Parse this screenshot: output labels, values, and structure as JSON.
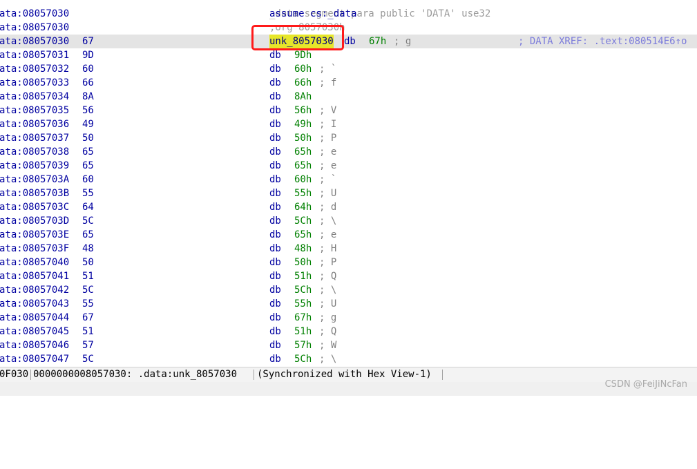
{
  "listing": {
    "partial_top": "_data segment para public 'DATA' use32",
    "rows": [
      {
        "addr": "ata:08057030",
        "bytes": "",
        "name": "assume cs:_data",
        "mnem": "",
        "val": "",
        "cmt": "",
        "xref": ""
      },
      {
        "addr": "ata:08057030",
        "bytes": "",
        "name": ";org 8057030h",
        "mnem": "",
        "val": "",
        "cmt": "",
        "xref": ""
      },
      {
        "addr": "ata:08057030",
        "bytes": "67",
        "name": "unk_8057030",
        "mnem": "db",
        "val": "67h",
        "cmt": "; g",
        "xref": "; DATA XREF: .text:080514E6↑o"
      },
      {
        "addr": "ata:08057031",
        "bytes": "9D",
        "name": "",
        "mnem": "db",
        "val": "9Dh",
        "cmt": "",
        "xref": ""
      },
      {
        "addr": "ata:08057032",
        "bytes": "60",
        "name": "",
        "mnem": "db",
        "val": "60h",
        "cmt": "; `",
        "xref": ""
      },
      {
        "addr": "ata:08057033",
        "bytes": "66",
        "name": "",
        "mnem": "db",
        "val": "66h",
        "cmt": "; f",
        "xref": ""
      },
      {
        "addr": "ata:08057034",
        "bytes": "8A",
        "name": "",
        "mnem": "db",
        "val": "8Ah",
        "cmt": "",
        "xref": ""
      },
      {
        "addr": "ata:08057035",
        "bytes": "56",
        "name": "",
        "mnem": "db",
        "val": "56h",
        "cmt": "; V",
        "xref": ""
      },
      {
        "addr": "ata:08057036",
        "bytes": "49",
        "name": "",
        "mnem": "db",
        "val": "49h",
        "cmt": "; I",
        "xref": ""
      },
      {
        "addr": "ata:08057037",
        "bytes": "50",
        "name": "",
        "mnem": "db",
        "val": "50h",
        "cmt": "; P",
        "xref": ""
      },
      {
        "addr": "ata:08057038",
        "bytes": "65",
        "name": "",
        "mnem": "db",
        "val": "65h",
        "cmt": "; e",
        "xref": ""
      },
      {
        "addr": "ata:08057039",
        "bytes": "65",
        "name": "",
        "mnem": "db",
        "val": "65h",
        "cmt": "; e",
        "xref": ""
      },
      {
        "addr": "ata:0805703A",
        "bytes": "60",
        "name": "",
        "mnem": "db",
        "val": "60h",
        "cmt": "; `",
        "xref": ""
      },
      {
        "addr": "ata:0805703B",
        "bytes": "55",
        "name": "",
        "mnem": "db",
        "val": "55h",
        "cmt": "; U",
        "xref": ""
      },
      {
        "addr": "ata:0805703C",
        "bytes": "64",
        "name": "",
        "mnem": "db",
        "val": "64h",
        "cmt": "; d",
        "xref": ""
      },
      {
        "addr": "ata:0805703D",
        "bytes": "5C",
        "name": "",
        "mnem": "db",
        "val": "5Ch",
        "cmt": "; \\",
        "xref": ""
      },
      {
        "addr": "ata:0805703E",
        "bytes": "65",
        "name": "",
        "mnem": "db",
        "val": "65h",
        "cmt": "; e",
        "xref": ""
      },
      {
        "addr": "ata:0805703F",
        "bytes": "48",
        "name": "",
        "mnem": "db",
        "val": "48h",
        "cmt": "; H",
        "xref": ""
      },
      {
        "addr": "ata:08057040",
        "bytes": "50",
        "name": "",
        "mnem": "db",
        "val": "50h",
        "cmt": "; P",
        "xref": ""
      },
      {
        "addr": "ata:08057041",
        "bytes": "51",
        "name": "",
        "mnem": "db",
        "val": "51h",
        "cmt": "; Q",
        "xref": ""
      },
      {
        "addr": "ata:08057042",
        "bytes": "5C",
        "name": "",
        "mnem": "db",
        "val": "5Ch",
        "cmt": "; \\",
        "xref": ""
      },
      {
        "addr": "ata:08057043",
        "bytes": "55",
        "name": "",
        "mnem": "db",
        "val": "55h",
        "cmt": "; U",
        "xref": ""
      },
      {
        "addr": "ata:08057044",
        "bytes": "67",
        "name": "",
        "mnem": "db",
        "val": "67h",
        "cmt": "; g",
        "xref": ""
      },
      {
        "addr": "ata:08057045",
        "bytes": "51",
        "name": "",
        "mnem": "db",
        "val": "51h",
        "cmt": "; Q",
        "xref": ""
      },
      {
        "addr": "ata:08057046",
        "bytes": "57",
        "name": "",
        "mnem": "db",
        "val": "57h",
        "cmt": "; W",
        "xref": ""
      },
      {
        "addr": "ata:08057047",
        "bytes": "5C",
        "name": "",
        "mnem": "db",
        "val": "5Ch",
        "cmt": "; \\",
        "xref": ""
      }
    ]
  },
  "status": {
    "offset": "0F030",
    "address": "0000000008057030: .data:unk_8057030",
    "sync": "(Synchronized with Hex View-1)"
  },
  "watermark": "CSDN @FeiJiNcFan",
  "colors": {
    "address": "#0000a0",
    "value": "#008000",
    "comment": "#808080",
    "xref": "#7b7bdb",
    "highlight": "#e6e62a",
    "box": "#ff1a1a"
  }
}
